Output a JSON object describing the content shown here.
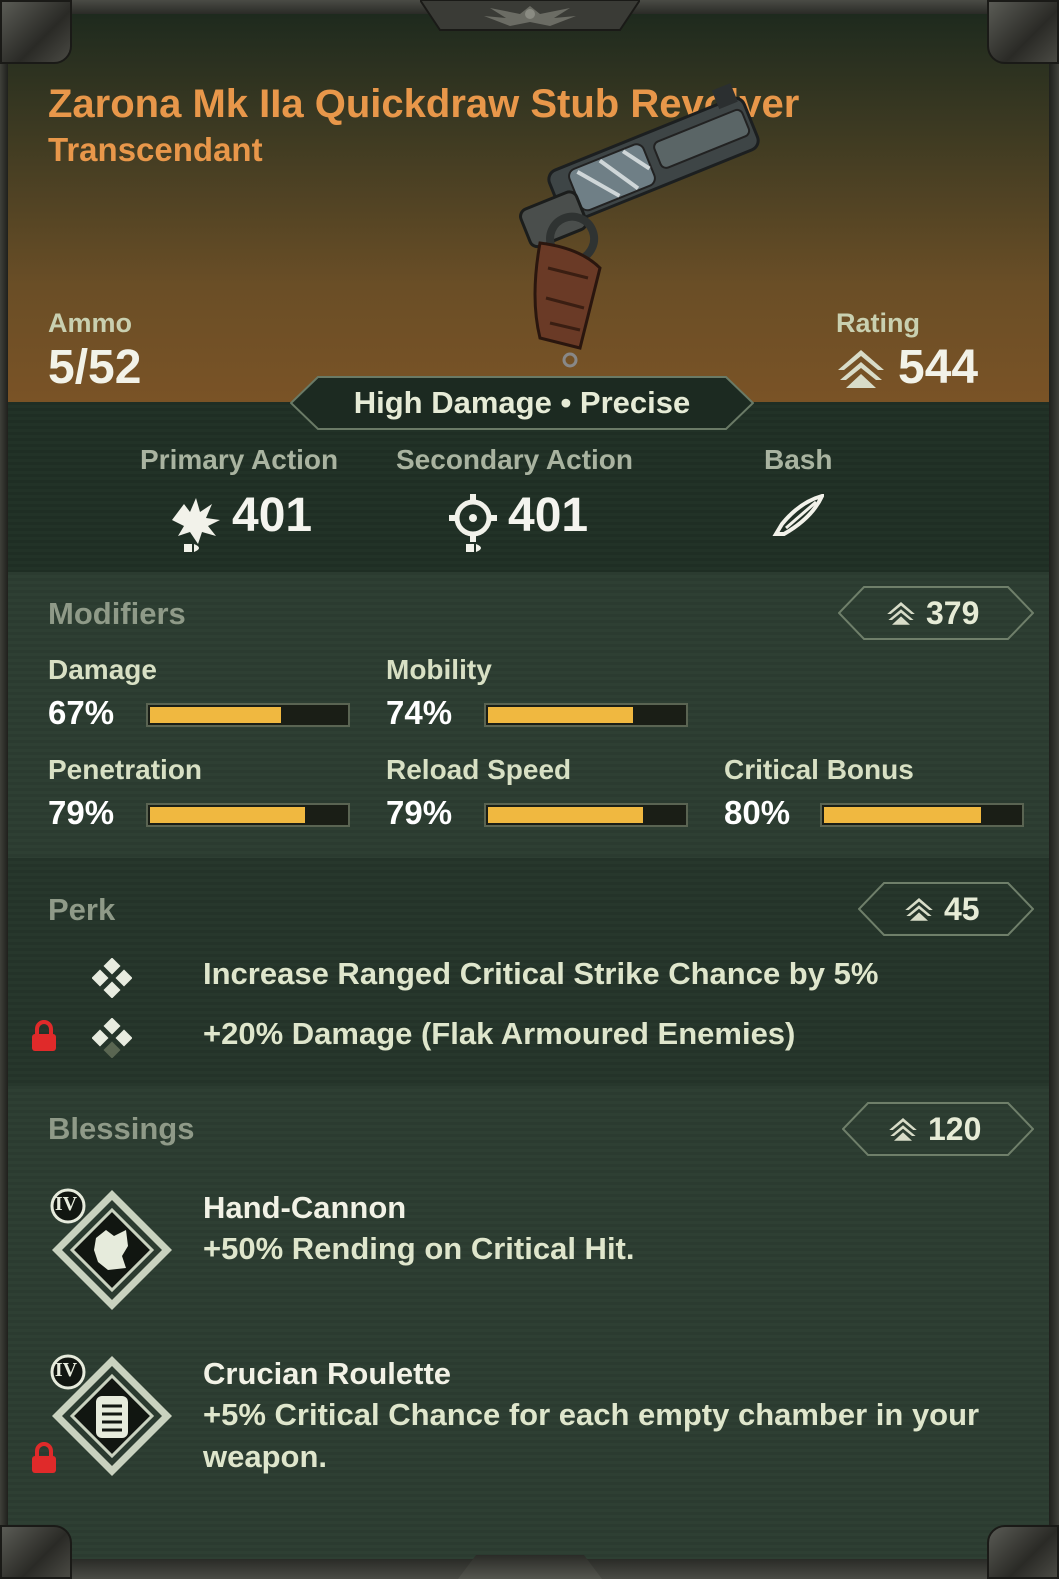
{
  "item": {
    "name": "Zarona Mk IIa Quickdraw Stub Revolver",
    "rarity": "Transcendant",
    "ammo_label": "Ammo",
    "ammo_value": "5/52",
    "rating_label": "Rating",
    "rating_value": "544",
    "tags": "High Damage • Precise"
  },
  "actions": [
    {
      "label": "Primary Action",
      "value": "401",
      "icon": "burst-fire-icon"
    },
    {
      "label": "Secondary Action",
      "value": "401",
      "icon": "crosshair-icon"
    },
    {
      "label": "Bash",
      "value": "",
      "icon": "blade-icon"
    }
  ],
  "modifiers": {
    "title": "Modifiers",
    "rating": "379",
    "stats": [
      {
        "label": "Damage",
        "value": "67%",
        "fraction": 0.67
      },
      {
        "label": "Mobility",
        "value": "74%",
        "fraction": 0.74
      },
      {
        "label": "Penetration",
        "value": "79%",
        "fraction": 0.79
      },
      {
        "label": "Reload Speed",
        "value": "79%",
        "fraction": 0.79
      },
      {
        "label": "Critical Bonus",
        "value": "80%",
        "fraction": 0.8
      }
    ]
  },
  "perk": {
    "title": "Perk",
    "rating": "45",
    "items": [
      {
        "text": "Increase Ranged Critical Strike Chance by 5%",
        "locked": false
      },
      {
        "text": "+20% Damage (Flak Armoured Enemies)",
        "locked": true
      }
    ]
  },
  "blessings": {
    "title": "Blessings",
    "rating": "120",
    "items": [
      {
        "tier": "IV",
        "name": "Hand-Cannon",
        "description": "+50% Rending on Critical Hit.",
        "icon": "hand-cannon-icon",
        "locked": false
      },
      {
        "tier": "IV",
        "name": "Crucian Roulette",
        "description": "+5% Critical Chance for each empty chamber in your weapon.",
        "icon": "crucian-roulette-icon",
        "locked": true
      }
    ]
  },
  "colors": {
    "title": "#e8974a",
    "bar_fill": "#f0b840",
    "lock": "#e02a2a",
    "panel": "#25342a"
  }
}
